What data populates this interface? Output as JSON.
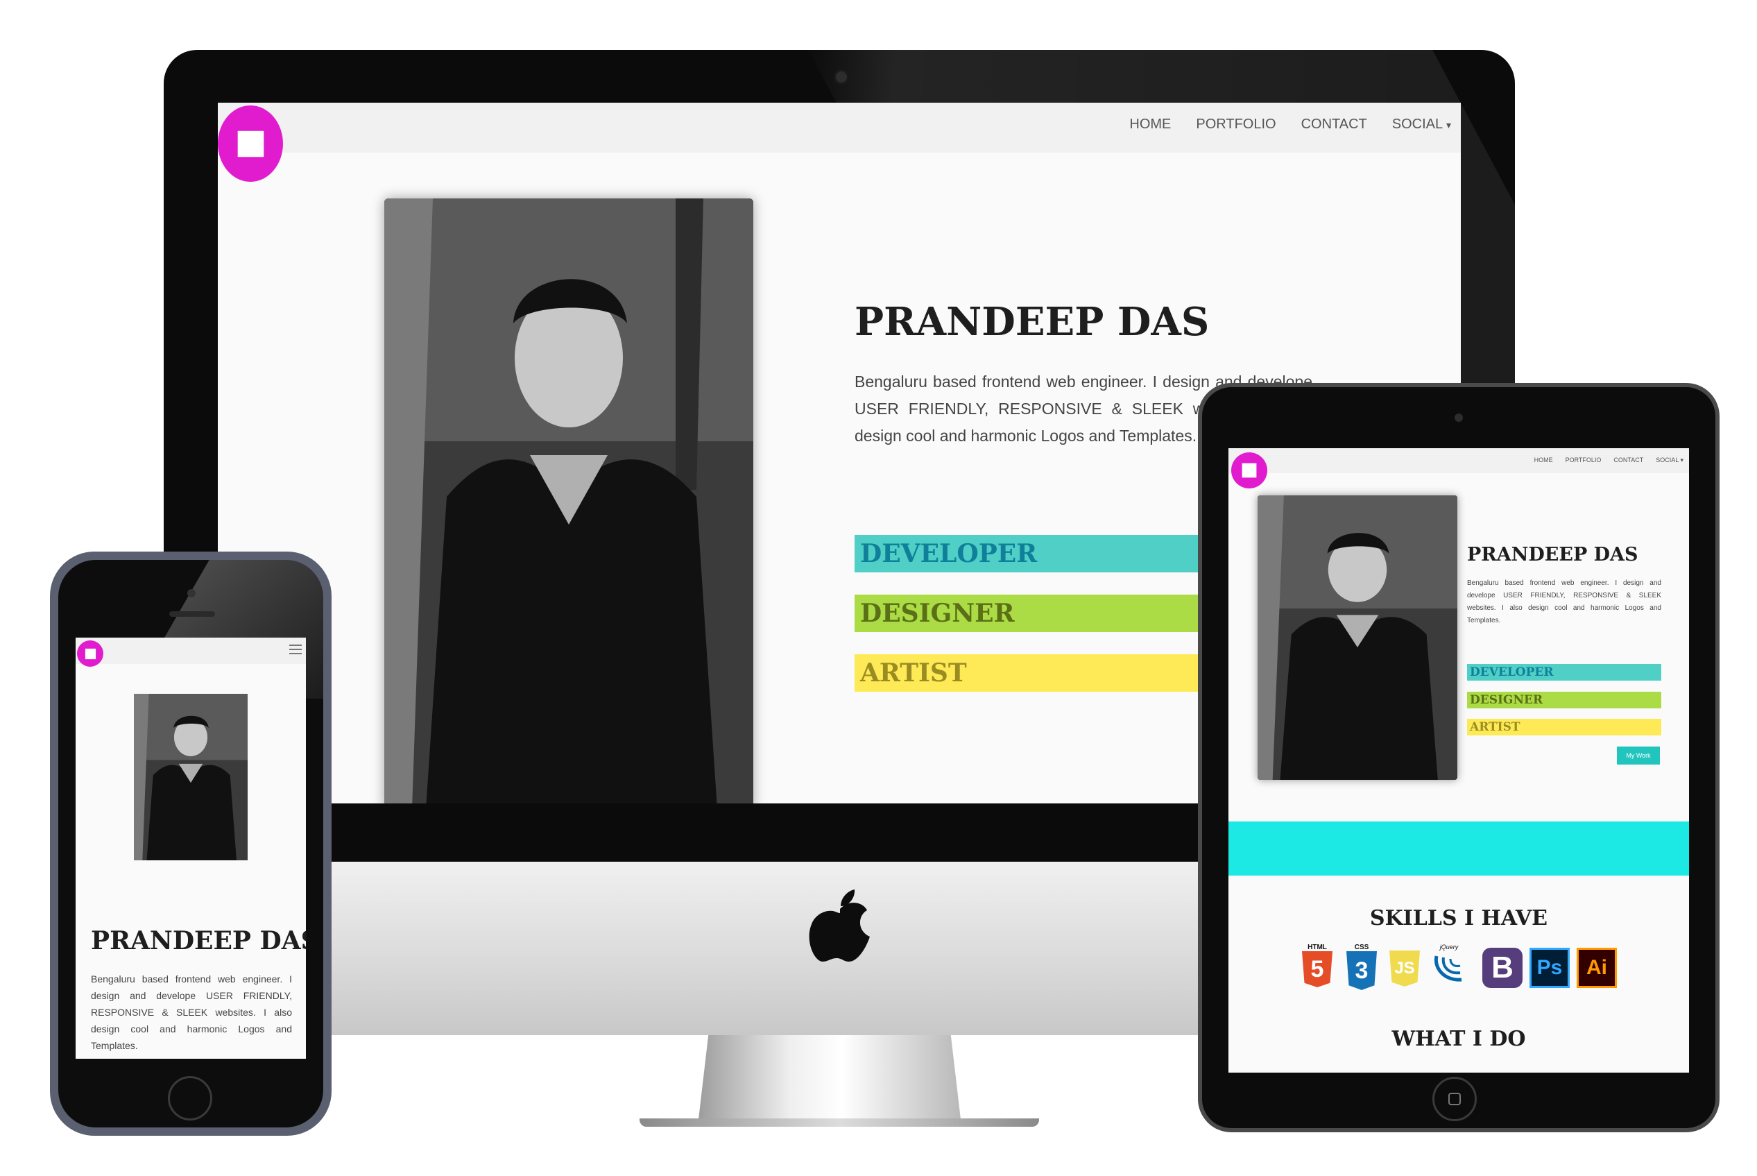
{
  "site": {
    "nav": {
      "items": [
        "HOME",
        "PORTFOLIO",
        "CONTACT",
        "SOCIAL"
      ],
      "social_caret": "▾"
    },
    "name": "PRANDEEP DAS",
    "bio": "Bengaluru based frontend web engineer. I design and develope USER FRIENDLY, RESPONSIVE & SLEEK websites. I also design cool and harmonic Logos and Templates.",
    "roles": [
      "DEVELOPER",
      "DESIGNER",
      "ARTIST"
    ],
    "button_label": "My Work",
    "skills_title": "SKILLS I HAVE",
    "skills": [
      {
        "name": "HTML",
        "glyph": "5",
        "color": "#e44d26"
      },
      {
        "name": "CSS",
        "glyph": "3",
        "color": "#1572b6"
      },
      {
        "name": "",
        "glyph": "JS",
        "color": "#f0db4f"
      },
      {
        "name": "jQuery",
        "glyph": "",
        "color": "#0769ad"
      },
      {
        "name": "",
        "glyph": "B",
        "color": "#563d7c"
      },
      {
        "name": "",
        "glyph": "Ps",
        "color": "#31a8ff"
      },
      {
        "name": "",
        "glyph": "Ai",
        "color": "#ff9a00"
      }
    ],
    "what_title": "WHAT I DO",
    "colors": {
      "logo": "#e11ccf",
      "developer": "#4fcfc6",
      "designer": "#acdc45",
      "artist": "#fdea56",
      "band": "#1de9e4",
      "button": "#22c5be"
    }
  },
  "devices": {
    "desktop": "imac",
    "tablet": "ipad",
    "phone": "iphone"
  }
}
